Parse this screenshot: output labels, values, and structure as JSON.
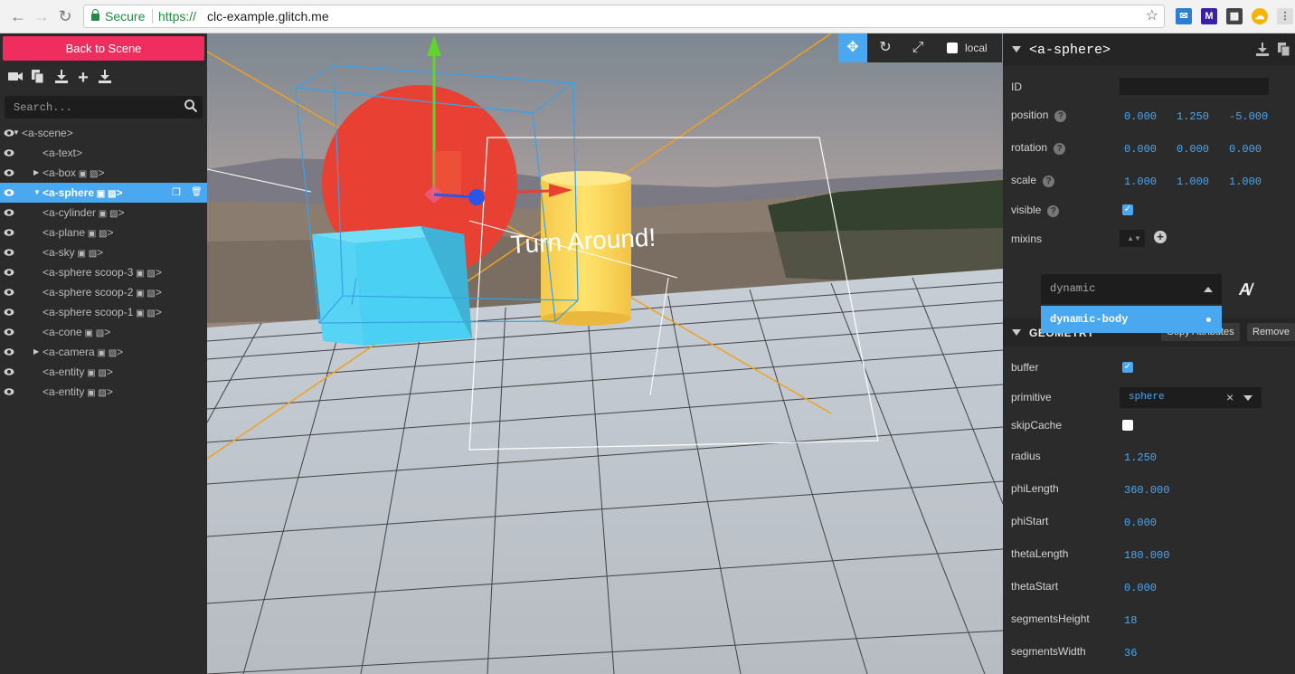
{
  "browser": {
    "secure_label": "Secure",
    "url_scheme": "https://",
    "url_host": "clc-example.glitch.me"
  },
  "sidebar": {
    "back_label": "Back to Scene",
    "search_placeholder": "Search...",
    "tree": [
      {
        "label": "<a-scene>",
        "indent": 0,
        "caret": "down"
      },
      {
        "label": "<a-text>",
        "indent": 1
      },
      {
        "label": "<a-box",
        "indent": 1,
        "caret": "right",
        "suffix": ">"
      },
      {
        "label": "<a-sphere",
        "indent": 1,
        "caret": "down",
        "suffix": ">",
        "selected": true
      },
      {
        "label": "<a-cylinder",
        "indent": 1,
        "suffix": ">"
      },
      {
        "label": "<a-plane",
        "indent": 1,
        "suffix": ">"
      },
      {
        "label": "<a-sky",
        "indent": 1,
        "suffix": ">"
      },
      {
        "label": "<a-sphere scoop-3",
        "indent": 1,
        "suffix": ">"
      },
      {
        "label": "<a-sphere scoop-2",
        "indent": 1,
        "suffix": ">"
      },
      {
        "label": "<a-sphere scoop-1",
        "indent": 1,
        "suffix": ">"
      },
      {
        "label": "<a-cone",
        "indent": 1,
        "suffix": ">"
      },
      {
        "label": "<a-camera",
        "indent": 1,
        "caret": "right",
        "suffix": ">"
      },
      {
        "label": "<a-entity",
        "indent": 1,
        "suffix": ">"
      },
      {
        "label": "<a-entity",
        "indent": 1,
        "suffix": ">"
      }
    ]
  },
  "viewport": {
    "scene_text": "Turn Around!",
    "local_label": "local"
  },
  "inspector": {
    "entity_title": "<a-sphere>",
    "id_label": "ID",
    "position_label": "position",
    "position": [
      "0.000",
      "1.250",
      "-5.000"
    ],
    "rotation_label": "rotation",
    "rotation": [
      "0.000",
      "0.000",
      "0.000"
    ],
    "scale_label": "scale",
    "scale": [
      "1.000",
      "1.000",
      "1.000"
    ],
    "visible_label": "visible",
    "mixins_label": "mixins",
    "component_search": "dynamic",
    "component_option": "dynamic-body",
    "geometry_title": "GEOMETRY",
    "copy_label": "Copy Attributes",
    "remove_label": "Remove",
    "buffer_label": "buffer",
    "primitive_label": "primitive",
    "primitive_value": "sphere",
    "skipcache_label": "skipCache",
    "geometry_props": [
      {
        "label": "radius",
        "value": "1.250"
      },
      {
        "label": "phiLength",
        "value": "360.000"
      },
      {
        "label": "phiStart",
        "value": "0.000"
      },
      {
        "label": "thetaLength",
        "value": "180.000"
      },
      {
        "label": "thetaStart",
        "value": "0.000"
      },
      {
        "label": "segmentsHeight",
        "value": "18"
      },
      {
        "label": "segmentsWidth",
        "value": "36"
      }
    ]
  }
}
